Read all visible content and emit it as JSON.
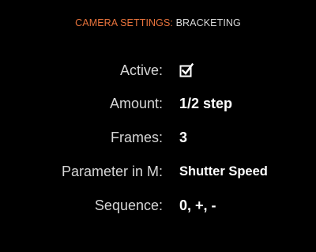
{
  "header": {
    "section": "CAMERA SETTINGS:",
    "page": "BRACKETING"
  },
  "settings": {
    "active": {
      "label": "Active:",
      "checked": true,
      "icon": "checkbox-checked-icon"
    },
    "amount": {
      "label": "Amount:",
      "value": "1/2 step"
    },
    "frames": {
      "label": "Frames:",
      "value": "3"
    },
    "parameter": {
      "label": "Parameter in M:",
      "value": "Shutter Speed"
    },
    "sequence": {
      "label": "Sequence:",
      "value": "0, +, -"
    }
  },
  "colors": {
    "background": "#000000",
    "accent": "#e8733c",
    "label": "#d6d6d6",
    "value": "#ffffff"
  }
}
